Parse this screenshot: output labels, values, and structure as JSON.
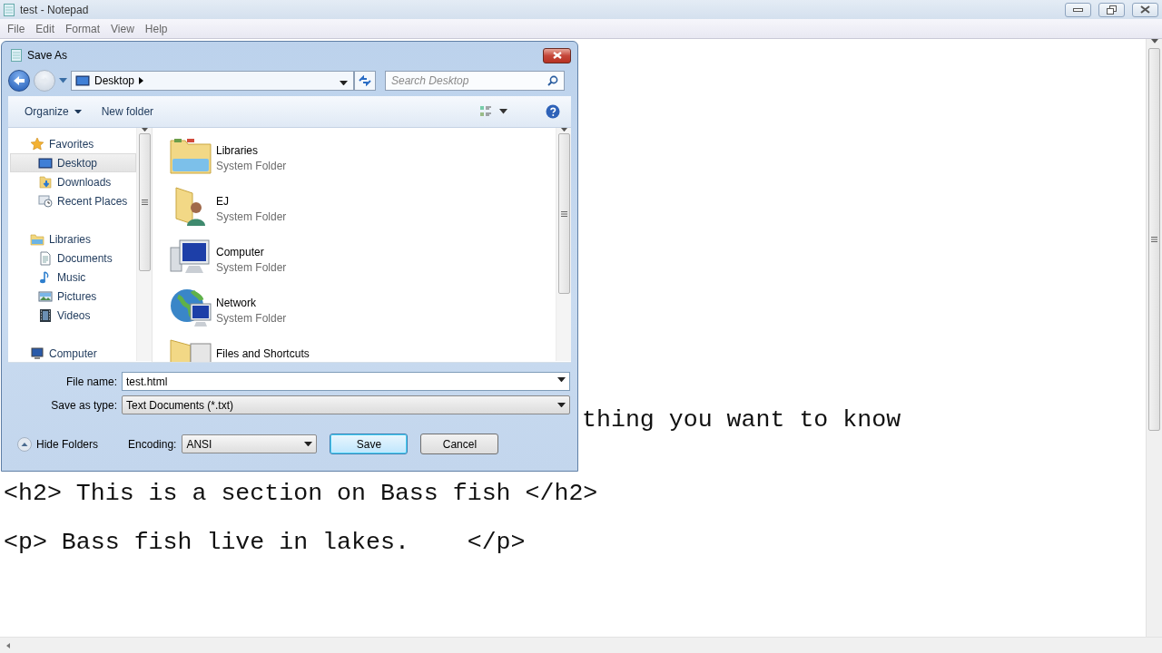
{
  "notepad": {
    "title": "test - Notepad",
    "menu": [
      {
        "label": "File"
      },
      {
        "label": "Edit"
      },
      {
        "label": "Format"
      },
      {
        "label": "View"
      },
      {
        "label": "Help"
      }
    ],
    "lines": [
      {
        "text": "thing you want to know",
        "kind": "partial"
      },
      {
        "text": "<h2> This is a section on Bass fish </h2>",
        "kind": "full"
      },
      {
        "text": "<p> Bass fish live in lakes.    </p>",
        "kind": "full"
      }
    ]
  },
  "dialog": {
    "title": "Save As",
    "location": "Desktop",
    "search": {
      "placeholder": "Search Desktop"
    },
    "toolbar": {
      "organize": "Organize",
      "new_folder": "New folder"
    },
    "nav": [
      {
        "label": "Favorites",
        "kind": "favorites",
        "selected": false,
        "children": [
          {
            "label": "Desktop",
            "kind": "desktop",
            "selected": true
          },
          {
            "label": "Downloads",
            "kind": "downloads",
            "selected": false
          },
          {
            "label": "Recent Places",
            "kind": "recent",
            "selected": false
          }
        ]
      },
      {
        "label": "Libraries",
        "kind": "libraries",
        "selected": false,
        "children": [
          {
            "label": "Documents",
            "kind": "documents",
            "selected": false
          },
          {
            "label": "Music",
            "kind": "music",
            "selected": false
          },
          {
            "label": "Pictures",
            "kind": "pictures",
            "selected": false
          },
          {
            "label": "Videos",
            "kind": "videos",
            "selected": false
          }
        ]
      },
      {
        "label": "Computer",
        "kind": "computer",
        "selected": false
      }
    ],
    "files": [
      {
        "name": "Libraries",
        "type": "System Folder",
        "kind": "libraries"
      },
      {
        "name": "EJ",
        "type": "System Folder",
        "kind": "user"
      },
      {
        "name": "Computer",
        "type": "System Folder",
        "kind": "computer"
      },
      {
        "name": "Network",
        "type": "System Folder",
        "kind": "network"
      },
      {
        "name": "Files and Shortcuts",
        "kind": "folder"
      }
    ],
    "file_name": {
      "label": "File name:",
      "value": "test.html"
    },
    "save_as_type": {
      "label": "Save as type:",
      "value": "Text Documents (*.txt)"
    },
    "hide_folders": "Hide Folders",
    "encoding": {
      "label": "Encoding:",
      "value": "ANSI"
    },
    "buttons": [
      {
        "label": "Save",
        "kind": "default"
      },
      {
        "label": "Cancel",
        "kind": "normal"
      }
    ]
  }
}
